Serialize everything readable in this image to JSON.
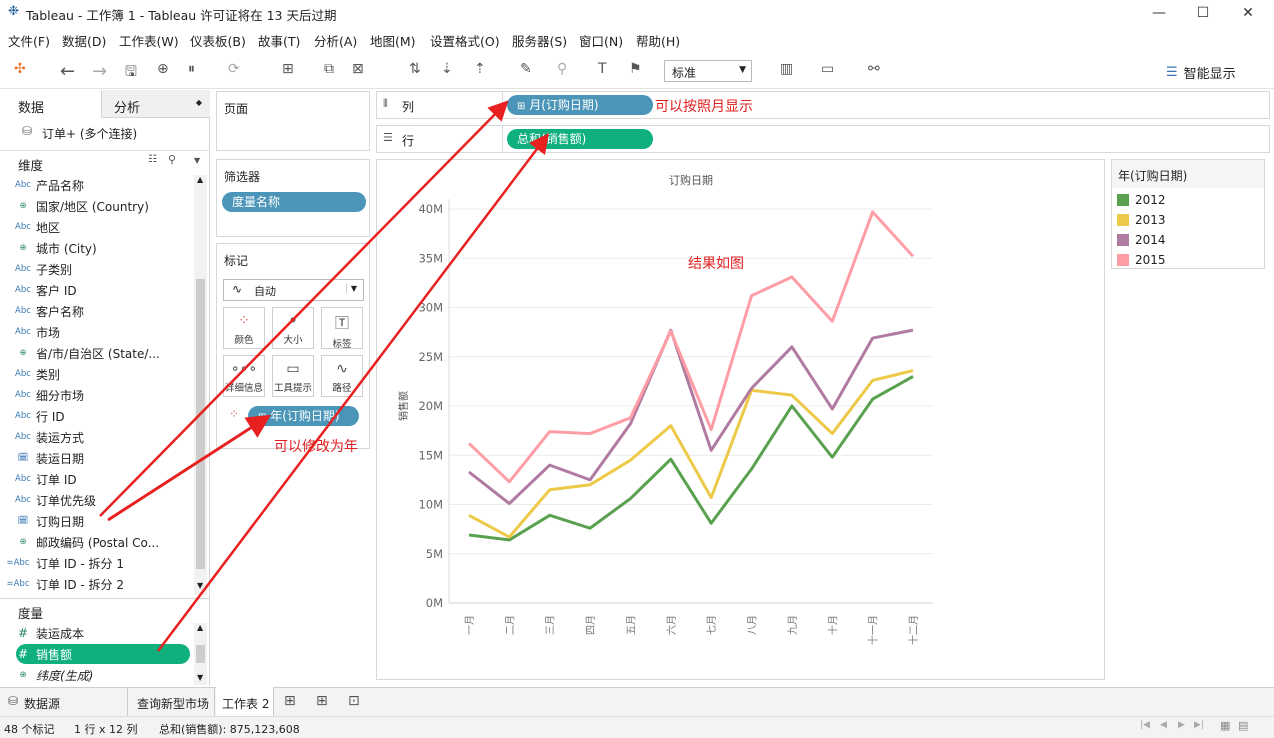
{
  "window": {
    "title": "Tableau - 工作簿 1 - Tableau 许可证将在 13 天后过期"
  },
  "menu": [
    "文件(F)",
    "数据(D)",
    "工作表(W)",
    "仪表板(B)",
    "故事(T)",
    "分析(A)",
    "地图(M)",
    "设置格式(O)",
    "服务器(S)",
    "窗口(N)",
    "帮助(H)"
  ],
  "toolbar": {
    "fit_select": "标准",
    "show_me": "智能显示"
  },
  "left": {
    "tab_data": "数据",
    "tab_analysis": "分析",
    "datasource": "订单+ (多个连接)",
    "dimensions_header": "维度",
    "dimensions": [
      {
        "icon": "Abc",
        "label": "产品名称"
      },
      {
        "icon": "globe",
        "label": "国家/地区 (Country)"
      },
      {
        "icon": "Abc",
        "label": "地区"
      },
      {
        "icon": "globe",
        "label": "城市 (City)"
      },
      {
        "icon": "Abc",
        "label": "子类别"
      },
      {
        "icon": "Abc",
        "label": "客户 ID"
      },
      {
        "icon": "Abc",
        "label": "客户名称"
      },
      {
        "icon": "Abc",
        "label": "市场"
      },
      {
        "icon": "globe",
        "label": "省/市/自治区 (State/..."
      },
      {
        "icon": "Abc",
        "label": "类别"
      },
      {
        "icon": "Abc",
        "label": "细分市场"
      },
      {
        "icon": "Abc",
        "label": "行 ID"
      },
      {
        "icon": "Abc",
        "label": "装运方式"
      },
      {
        "icon": "calendar",
        "label": "装运日期"
      },
      {
        "icon": "Abc",
        "label": "订单 ID"
      },
      {
        "icon": "Abc",
        "label": "订单优先级"
      },
      {
        "icon": "calendar",
        "label": "订购日期"
      },
      {
        "icon": "globe",
        "label": "邮政编码 (Postal Co..."
      }
    ],
    "split_fields": [
      {
        "icon": "=Abc",
        "label": "订单 ID - 拆分 1"
      },
      {
        "icon": "=Abc",
        "label": "订单 ID - 拆分 2"
      }
    ],
    "measures_header": "度量",
    "measures": [
      {
        "icon": "#",
        "label": "装运成本"
      },
      {
        "icon": "#",
        "label": "销售额"
      },
      {
        "icon": "globe",
        "label": "纬度(生成)"
      }
    ]
  },
  "cards": {
    "pages": "页面",
    "filters": "筛选器",
    "filter_pill": "度量名称",
    "marks": "标记",
    "mark_type": "自动",
    "mark_buttons": [
      "颜色",
      "大小",
      "标签",
      "详细信息",
      "工具提示",
      "路径"
    ],
    "color_pill": "年(订购日期)"
  },
  "shelves": {
    "columns_label": "列",
    "columns_pill": "月(订购日期)",
    "rows_label": "行",
    "rows_pill": "总和(销售额)"
  },
  "annotations": {
    "by_month": "可以按照月显示",
    "result": "结果如图",
    "change_year": "可以修改为年"
  },
  "legend": {
    "title": "年(订购日期)",
    "items": [
      {
        "label": "2012",
        "color": "#59a14f"
      },
      {
        "label": "2013",
        "color": "#edc948"
      },
      {
        "label": "2014",
        "color": "#b07aa1"
      },
      {
        "label": "2015",
        "color": "#ff9da7"
      }
    ]
  },
  "chart_data": {
    "type": "line",
    "title": "订购日期",
    "ylabel": "销售额",
    "categories": [
      "一月",
      "二月",
      "三月",
      "四月",
      "五月",
      "六月",
      "七月",
      "八月",
      "九月",
      "十月",
      "十一月",
      "十二月"
    ],
    "yticks": [
      "0M",
      "5M",
      "10M",
      "15M",
      "20M",
      "25M",
      "30M",
      "35M",
      "40M"
    ],
    "ylim": [
      0,
      40000000
    ],
    "series": [
      {
        "name": "2012",
        "color": "#59a14f",
        "values": [
          6900000,
          6400000,
          8900000,
          7600000,
          10600000,
          14600000,
          8100000,
          13600000,
          20000000,
          14800000,
          20700000,
          23000000
        ]
      },
      {
        "name": "2013",
        "color": "#edc948",
        "values": [
          8900000,
          6700000,
          11500000,
          12000000,
          14500000,
          18000000,
          10700000,
          21600000,
          21100000,
          17200000,
          22600000,
          23600000
        ]
      },
      {
        "name": "2014",
        "color": "#b07aa1",
        "values": [
          13300000,
          10100000,
          14000000,
          12500000,
          18200000,
          27700000,
          15500000,
          21800000,
          26000000,
          19700000,
          26900000,
          27700000
        ]
      },
      {
        "name": "2015",
        "color": "#ff9da7",
        "values": [
          16200000,
          12300000,
          17400000,
          17200000,
          18800000,
          27600000,
          17600000,
          31200000,
          33100000,
          28600000,
          39700000,
          35200000
        ]
      }
    ]
  },
  "tabs": {
    "datasource": "数据源",
    "sheet1": "查询新型市场",
    "sheet2": "工作表 2"
  },
  "status": {
    "marks": "48 个标记",
    "rows_cols": "1 行 x 12 列",
    "sum": "总和(销售额): 875,123,608"
  }
}
